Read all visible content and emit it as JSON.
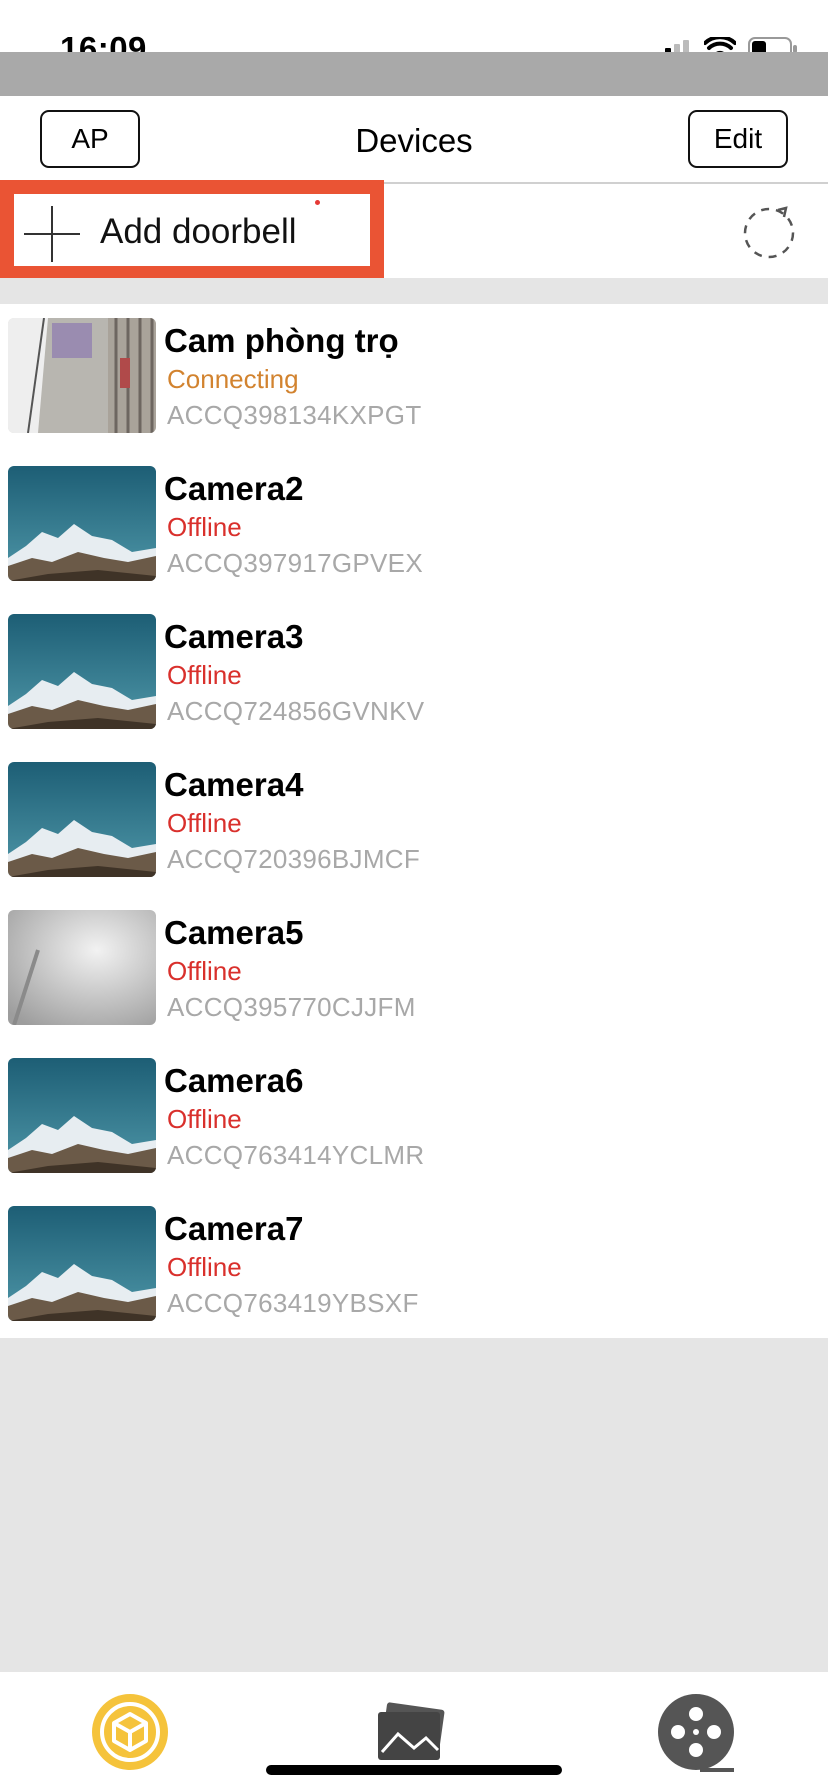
{
  "status_bar": {
    "time": "16:09"
  },
  "nav": {
    "left_button": "AP",
    "title": "Devices",
    "right_button": "Edit"
  },
  "add_row": {
    "label": "Add doorbell"
  },
  "devices": [
    {
      "name": "Cam phòng trọ",
      "status": "Connecting",
      "serial": "ACCQ398134KXPGT",
      "thumbnail": "room-hallway"
    },
    {
      "name": "Camera2",
      "status": "Offline",
      "serial": "ACCQ397917GPVEX",
      "thumbnail": "mountain"
    },
    {
      "name": "Camera3",
      "status": "Offline",
      "serial": "ACCQ724856GVNKV",
      "thumbnail": "mountain"
    },
    {
      "name": "Camera4",
      "status": "Offline",
      "serial": "ACCQ720396BJMCF",
      "thumbnail": "mountain"
    },
    {
      "name": "Camera5",
      "status": "Offline",
      "serial": "ACCQ395770CJJFM",
      "thumbnail": "gray-blur"
    },
    {
      "name": "Camera6",
      "status": "Offline",
      "serial": "ACCQ763414YCLMR",
      "thumbnail": "mountain"
    },
    {
      "name": "Camera7",
      "status": "Offline",
      "serial": "ACCQ763419YBSXF",
      "thumbnail": "mountain"
    }
  ],
  "colors": {
    "offline": "#d9302c",
    "connecting": "#d2832f",
    "serial": "#a8a8a8",
    "highlight": "#ea5434",
    "tab_active": "#f5c33b"
  },
  "tabs": [
    "devices-tab-icon",
    "gallery-tab-icon",
    "reel-tab-icon"
  ]
}
